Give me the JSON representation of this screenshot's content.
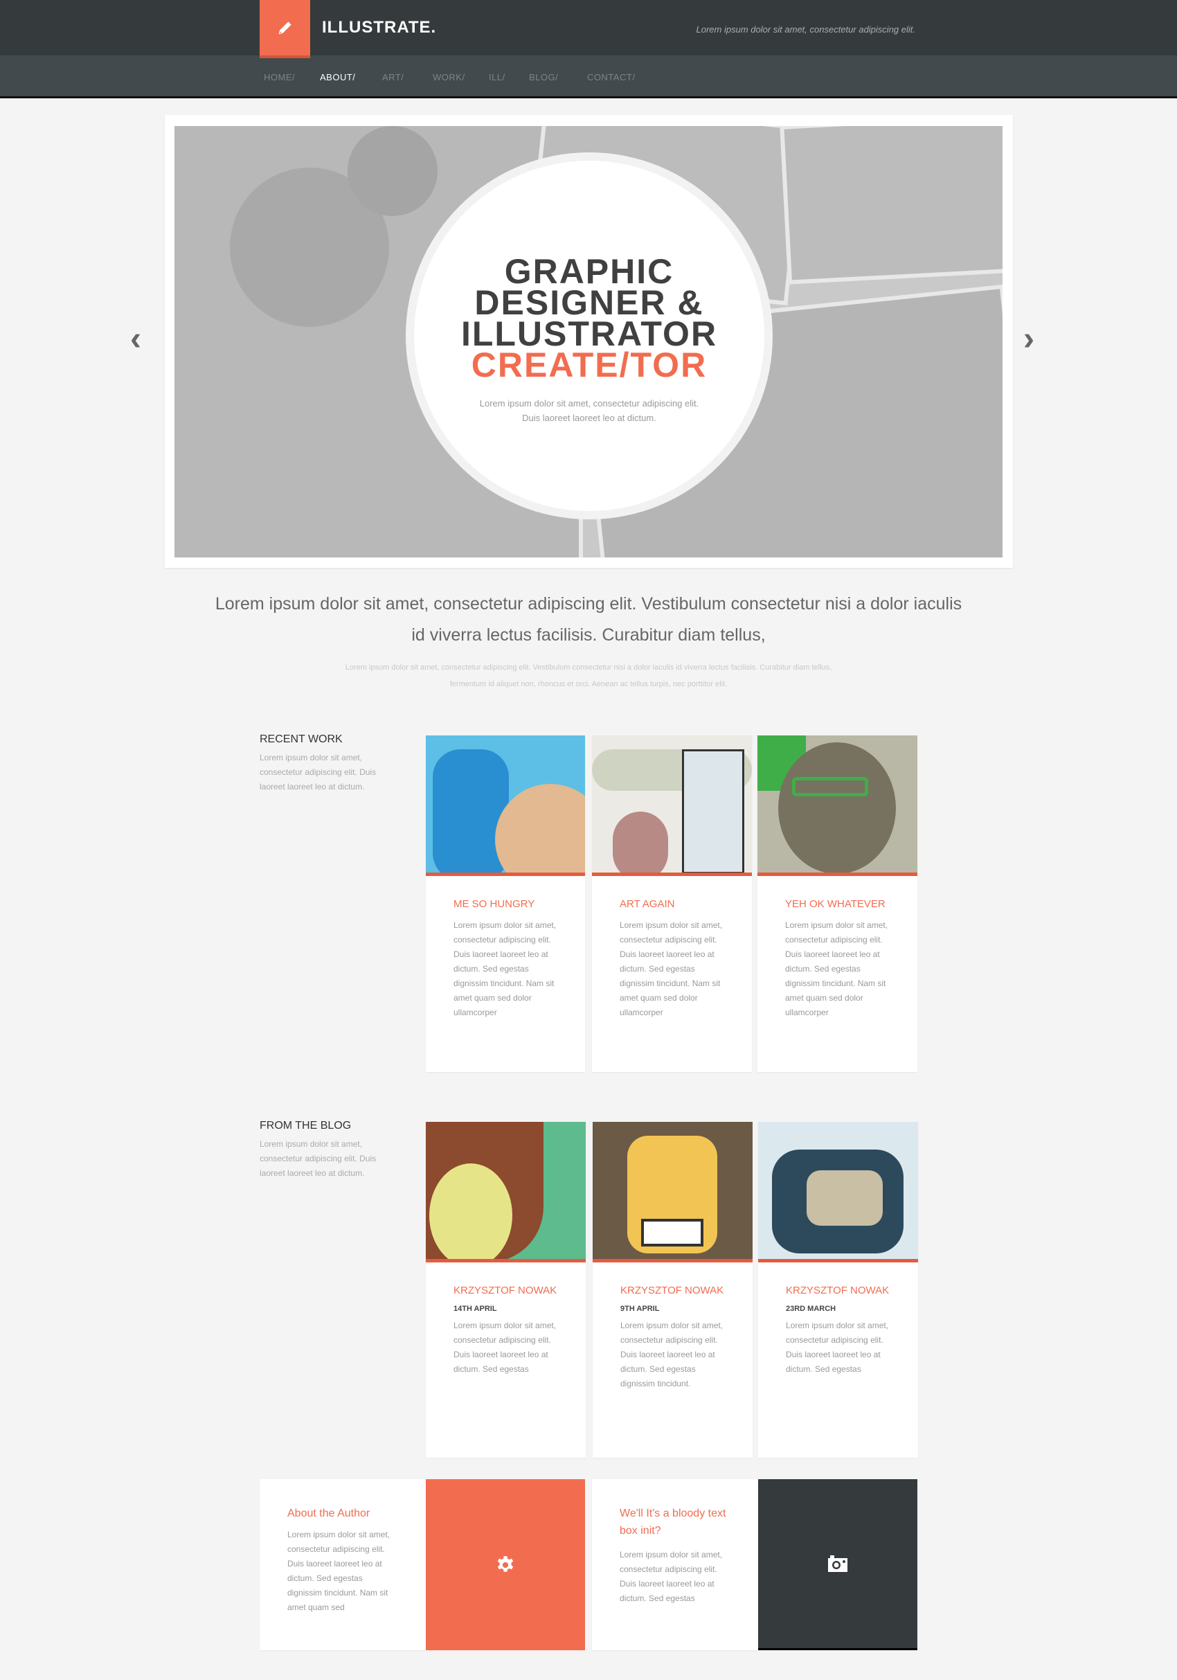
{
  "header": {
    "title": "ILLUSTRATE.",
    "tagline": "Lorem ipsum dolor sit amet, consectetur adipiscing elit.",
    "logo_icon": "pencil-icon"
  },
  "nav": [
    {
      "label": "HOME/"
    },
    {
      "label": "ABOUT/",
      "active": true
    },
    {
      "label": "ART/"
    },
    {
      "label": "WORK/"
    },
    {
      "label": "ILL/"
    },
    {
      "label": "BLOG/"
    },
    {
      "label": "CONTACT/"
    }
  ],
  "hero": {
    "lines": [
      "GRAPHIC",
      "DESIGNER &",
      "ILLUSTRATOR"
    ],
    "accent_line": "CREATE/TOR",
    "sub1": "Lorem ipsum dolor sit amet, consectetur adipiscing elit.",
    "sub2": "Duis laoreet laoreet leo at dictum.",
    "prev": "‹",
    "next": "›"
  },
  "intro": {
    "large": "Lorem ipsum dolor sit amet, consectetur adipiscing elit. Vestibulum consectetur nisi a dolor iaculis id viverra lectus facilisis. Curabitur diam tellus,",
    "small": "Lorem ipsum dolor sit amet, consectetur adipiscing elit. Vestibulum consectetur nisi a dolor iaculis id viverra lectus facilisis. Curabitur diam tellus, fermentum id aliquet non, rhoncus et orci. Aenean ac tellus turpis, nec porttitor elit."
  },
  "recent": {
    "label": "RECENT WORK",
    "desc": "Lorem ipsum dolor sit amet, consectetur adipiscing elit. Duis laoreet laoreet leo at dictum.",
    "cards": [
      {
        "title": "ME SO HUNGRY",
        "text": "Lorem ipsum dolor sit amet, consectetur adipiscing elit. Duis laoreet laoreet leo at dictum. Sed egestas dignissim tincidunt. Nam sit amet quam sed dolor ullamcorper"
      },
      {
        "title": "ART AGAIN",
        "text": "Lorem ipsum dolor sit amet, consectetur adipiscing elit. Duis laoreet laoreet leo at dictum. Sed egestas dignissim tincidunt. Nam sit amet quam sed dolor ullamcorper"
      },
      {
        "title": "YEH OK WHATEVER",
        "text": "Lorem ipsum dolor sit amet, consectetur adipiscing elit. Duis laoreet laoreet leo at dictum. Sed egestas dignissim tincidunt. Nam sit amet quam sed dolor ullamcorper"
      }
    ]
  },
  "blog": {
    "label": "FROM THE BLOG",
    "desc": "Lorem ipsum dolor sit amet, consectetur adipiscing elit. Duis laoreet laoreet leo at dictum.",
    "cards": [
      {
        "title": "KRZYSZTOF NOWAK",
        "date": "14TH APRIL",
        "text": "Lorem ipsum dolor sit amet, consectetur adipiscing elit. Duis laoreet laoreet leo at dictum. Sed egestas"
      },
      {
        "title": "KRZYSZTOF NOWAK",
        "date": "9TH APRIL",
        "text": "Lorem ipsum dolor sit amet, consectetur adipiscing elit. Duis laoreet laoreet leo at dictum. Sed egestas dignissim tincidunt."
      },
      {
        "title": "KRZYSZTOF NOWAK",
        "date": "23RD MARCH",
        "text": "Lorem ipsum dolor sit amet, consectetur adipiscing elit. Duis laoreet laoreet leo at dictum. Sed egestas"
      }
    ]
  },
  "bottom": {
    "author": {
      "title": "About the Author",
      "text": "Lorem ipsum dolor sit amet, consectetur adipiscing elit. Duis laoreet laoreet leo at dictum. Sed egestas dignissim tincidunt. Nam sit amet quam sed"
    },
    "textbox": {
      "title": "We'll It's a bloody text box init?",
      "text": "Lorem ipsum dolor sit amet, consectetur adipiscing elit. Duis laoreet laoreet leo at dictum. Sed egestas"
    },
    "icons": [
      "gear-icon",
      "camera-icon"
    ]
  },
  "colors": {
    "accent": "#f26c4f",
    "dark": "#353b3d",
    "nav": "#434a4d"
  }
}
